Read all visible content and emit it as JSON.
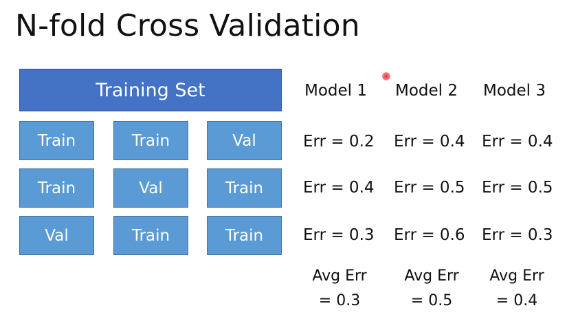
{
  "title": "N-fold Cross Validation",
  "training_set": "Training Set",
  "folds": [
    [
      "Train",
      "Train",
      "Val"
    ],
    [
      "Train",
      "Val",
      "Train"
    ],
    [
      "Val",
      "Train",
      "Train"
    ]
  ],
  "models": [
    {
      "name": "Model 1",
      "errors": [
        "Err = 0.2",
        "Err = 0.4",
        "Err = 0.3"
      ],
      "avg_line1": "Avg Err",
      "avg_line2": "= 0.3"
    },
    {
      "name": "Model 2",
      "errors": [
        "Err = 0.4",
        "Err = 0.5",
        "Err = 0.6"
      ],
      "avg_line1": "Avg Err",
      "avg_line2": "= 0.5"
    },
    {
      "name": "Model 3",
      "errors": [
        "Err = 0.4",
        "Err = 0.5",
        "Err = 0.3"
      ],
      "avg_line1": "Avg Err",
      "avg_line2": "= 0.4"
    }
  ],
  "colors": {
    "training_set_fill": "#4472c4",
    "fold_fill": "#5b9bd5",
    "pointer": "#e8323a"
  }
}
